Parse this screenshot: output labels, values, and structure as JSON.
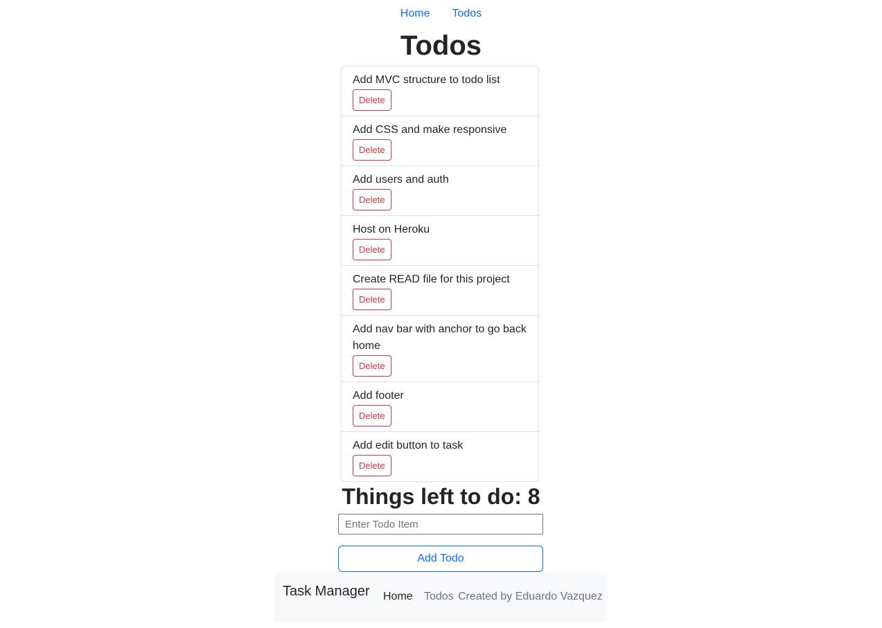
{
  "nav": {
    "home_label": "Home",
    "todos_label": "Todos"
  },
  "page": {
    "title": "Todos"
  },
  "todos": [
    {
      "text": "Add MVC structure to todo list",
      "delete_label": "Delete"
    },
    {
      "text": "Add CSS and make responsive",
      "delete_label": "Delete"
    },
    {
      "text": "Add users and auth",
      "delete_label": "Delete"
    },
    {
      "text": "Host on Heroku",
      "delete_label": "Delete"
    },
    {
      "text": "Create READ file for this project",
      "delete_label": "Delete"
    },
    {
      "text": "Add nav bar with anchor to go back home",
      "delete_label": "Delete"
    },
    {
      "text": "Add footer",
      "delete_label": "Delete"
    },
    {
      "text": "Add edit button to task",
      "delete_label": "Delete"
    }
  ],
  "summary": {
    "left_text": "Things left to do: 8"
  },
  "form": {
    "input_value": "",
    "input_placeholder": "Enter Todo Item",
    "add_label": "Add Todo"
  },
  "footer": {
    "brand": "Task Manager",
    "home_label": "Home",
    "todos_label": "Todos",
    "credit": "Created by Eduardo Vazquez"
  },
  "colors": {
    "link": "#0d6efd",
    "danger": "#dc3545",
    "footer_bg": "#f8f9fa",
    "muted": "#6c757d"
  }
}
